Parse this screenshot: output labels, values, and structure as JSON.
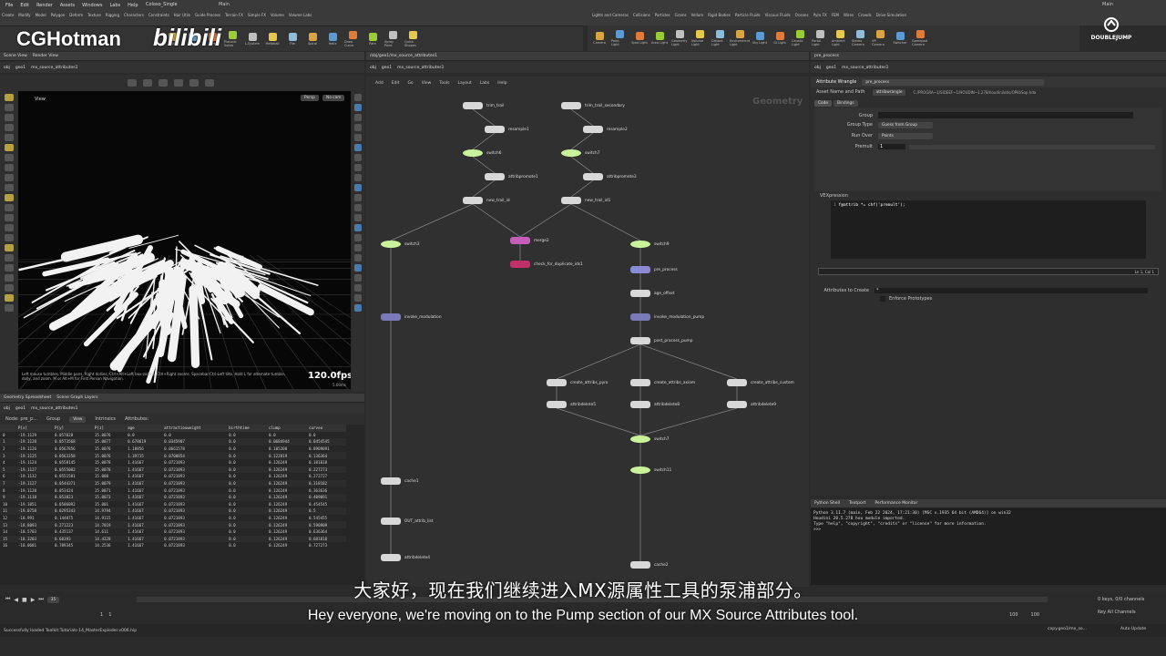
{
  "watermark": {
    "left": "CGHotman",
    "right": "bilibili",
    "brand_right": "DOUBLEJUMP"
  },
  "menubar": {
    "items": [
      "File",
      "Edit",
      "Render",
      "Assets",
      "Windows",
      "Labs",
      "Help"
    ],
    "desktop": "Coloso_Single",
    "main": "Main"
  },
  "shelf_left": [
    "Create",
    "Modify",
    "Model",
    "Polygon",
    "Deform",
    "Texture",
    "Rigging",
    "Characters",
    "Constraints",
    "Hair Utils",
    "Guide Process",
    "Terrain FX",
    "Simple FX",
    "Volume",
    "Volume Labs"
  ],
  "shelf_left_tools": [
    "Null",
    "Text",
    "Font",
    "Platonic Solids",
    "L-System",
    "Metaball",
    "File",
    "Spiral",
    "Helix",
    "Draw Curve",
    "Path",
    "Spray Paint",
    "Quick Shapes"
  ],
  "shelf_right": [
    "Lights and Cameras",
    "Collisions",
    "Particles",
    "Grains",
    "Vellum",
    "Rigid Bodies",
    "Particle Fluids",
    "Viscous Fluids",
    "Oceans",
    "Pyro FX",
    "FEM",
    "Wires",
    "Crowds",
    "Drive Simulation"
  ],
  "shelf_right_tools": [
    "Camera",
    "Point Light",
    "Spot Light",
    "Area Light",
    "Geometry Light",
    "Volume Light",
    "Distant Light",
    "Environment Light",
    "Sky Light",
    "GI Light",
    "Caustic Light",
    "Portal Light",
    "Ambient Light",
    "Stereo Camera",
    "VR Camera",
    "Switcher",
    "Gamepad Camera"
  ],
  "viewport": {
    "tabs": [
      "Scene View",
      "Render View"
    ],
    "path": [
      "obj",
      "geo1",
      "mx_source_attributes1"
    ],
    "view_label": "View",
    "persp": "Persp",
    "cam": "No cam",
    "fps": "120.0fps",
    "fps_ms": "5.69ms",
    "hint": "Left mouse tumbles. Middle pans. Right dollies. Ctrl+Alt+Left box-zooms. Ctrl+Right zooms. Spacebar-Ctrl-Left tilts. Hold L for alternate tumble, dolly, and zoom. M or Alt+M for First Person Navigation."
  },
  "spreadsheet": {
    "tabs": [
      "Geometry Spreadsheet",
      "Scene Graph Layers"
    ],
    "path": [
      "obj",
      "geo1",
      "mx_source_attributes1"
    ],
    "node_label": "Node: pre_p...",
    "group_label": "Group",
    "view_label": "View",
    "intrinsics_label": "Intrinsics",
    "attributes_label": "Attributes:",
    "columns": [
      "",
      "P[x]",
      "P[y]",
      "P[z]",
      "age",
      "attractiouweight",
      "birthtime",
      "clump",
      "curveu"
    ],
    "rows": [
      [
        "0",
        "-19.1129",
        "0.057028",
        "15.0076",
        "0.0",
        "0.0",
        "0.0",
        "0.0",
        "0.0"
      ],
      [
        "1",
        "-19.1128",
        "0.0573568",
        "15.0077",
        "0.678619",
        "0.0345907",
        "0.0",
        "0.0684944",
        "0.0454545"
      ],
      [
        "2",
        "-19.1126",
        "0.0567856",
        "15.0076",
        "1.18856",
        "0.0661578",
        "0.0",
        "0.105208",
        "0.0909091"
      ],
      [
        "3",
        "-19.1125",
        "0.0563358",
        "15.0076",
        "1.39715",
        "0.0700854",
        "0.0",
        "0.122819",
        "0.136364"
      ],
      [
        "4",
        "-19.1124",
        "0.0558145",
        "15.0078",
        "1.41667",
        "0.0721893",
        "0.0",
        "0.126249",
        "0.181818"
      ],
      [
        "5",
        "-19.1127",
        "0.0555082",
        "15.0078",
        "1.41667",
        "0.0721893",
        "0.0",
        "0.126249",
        "0.227273"
      ],
      [
        "6",
        "-19.1132",
        "0.0551581",
        "15.008",
        "1.41667",
        "0.0721893",
        "0.0",
        "0.126249",
        "0.272727"
      ],
      [
        "7",
        "-19.1127",
        "0.0544371",
        "15.0079",
        "1.41667",
        "0.0721893",
        "0.0",
        "0.126249",
        "0.318182"
      ],
      [
        "8",
        "-19.1128",
        "0.053424",
        "15.0071",
        "1.41667",
        "0.0721893",
        "0.0",
        "0.126249",
        "0.363636"
      ],
      [
        "9",
        "-19.1118",
        "0.053023",
        "15.0073",
        "1.41667",
        "0.0721893",
        "0.0",
        "0.126249",
        "0.409091"
      ],
      [
        "10",
        "-19.1051",
        "0.0506092",
        "15.001",
        "1.41667",
        "0.0721893",
        "0.0",
        "0.126249",
        "0.454545"
      ],
      [
        "11",
        "-19.0758",
        "0.0295343",
        "14.9794",
        "1.41667",
        "0.0721893",
        "0.0",
        "0.126249",
        "0.5"
      ],
      [
        "12",
        "-18.991",
        "0.144075",
        "14.9115",
        "1.41667",
        "0.0721893",
        "0.0",
        "0.126249",
        "0.545455"
      ],
      [
        "13",
        "-18.8093",
        "0.271223",
        "14.7819",
        "1.41667",
        "0.0721893",
        "0.0",
        "0.126249",
        "0.590909"
      ],
      [
        "14",
        "-18.5703",
        "0.435137",
        "14.611",
        "1.41667",
        "0.0721893",
        "0.0",
        "0.126249",
        "0.636364"
      ],
      [
        "15",
        "-18.3203",
        "0.60393",
        "14.4328",
        "1.41667",
        "0.0721893",
        "0.0",
        "0.126249",
        "0.681818"
      ],
      [
        "16",
        "-18.0681",
        "0.789345",
        "14.2536",
        "1.41667",
        "0.0721893",
        "0.0",
        "0.126249",
        "0.727273"
      ]
    ]
  },
  "network": {
    "tab": "/obj/geo1/mx_source_attributes1",
    "path": [
      "obj",
      "geo1",
      "mx_source_attributes1"
    ],
    "menu": [
      "Add",
      "Edit",
      "Go",
      "View",
      "Tools",
      "Layout",
      "Labs",
      "Help"
    ],
    "context_label": "Geometry",
    "nodes": [
      {
        "label": "trim_trail",
        "color": "#d8d8d8"
      },
      {
        "label": "resample1",
        "color": "#d8d8d8"
      },
      {
        "label": "switch6",
        "color": "#c9f29b"
      },
      {
        "label": "attribpromote1",
        "color": "#d8d8d8"
      },
      {
        "label": "new_trail_id",
        "color": "#d8d8d8"
      },
      {
        "label": "trim_trail_secondary",
        "color": "#d8d8d8"
      },
      {
        "label": "resample2",
        "color": "#d8d8d8"
      },
      {
        "label": "switch7",
        "color": "#c9f29b"
      },
      {
        "label": "attribpromote3",
        "color": "#d8d8d8"
      },
      {
        "label": "new_trail_id1",
        "color": "#d8d8d8"
      },
      {
        "label": "switch3",
        "color": "#c9f29b"
      },
      {
        "label": "merge2",
        "color": "#c35fb8"
      },
      {
        "label": "check_for_duplicate_ids1",
        "color": "#c0306a"
      },
      {
        "label": "switch9",
        "color": "#c9f29b"
      },
      {
        "label": "pre_process",
        "color": "#8a8ad8"
      },
      {
        "label": "age_offset",
        "color": "#d8d8d8"
      },
      {
        "label": "invoke_modulation",
        "color": "#7a7ab8"
      },
      {
        "label": "invoke_modulation_pump",
        "color": "#7a7ab8"
      },
      {
        "label": "post_process_pump",
        "color": "#d8d8d8"
      },
      {
        "label": "create_attribs_pyro",
        "color": "#d8d8d8"
      },
      {
        "label": "create_attribs_axiom",
        "color": "#d8d8d8"
      },
      {
        "label": "create_attribs_custom",
        "color": "#d8d8d8"
      },
      {
        "label": "attribdelete5",
        "color": "#d8d8d8"
      },
      {
        "label": "attribdelete8",
        "color": "#d8d8d8"
      },
      {
        "label": "attribdelete9",
        "color": "#d8d8d8"
      },
      {
        "label": "switch7",
        "color": "#c9f29b"
      },
      {
        "label": "switch11",
        "color": "#c9f29b"
      },
      {
        "label": "cache1",
        "color": "#d8d8d8"
      },
      {
        "label": "OUT_attrib_list",
        "color": "#d8d8d8"
      },
      {
        "label": "attribdelete4",
        "color": "#d8d8d8"
      },
      {
        "label": "cache2",
        "color": "#d8d8d8"
      }
    ]
  },
  "params": {
    "tab": "pre_process",
    "path": [
      "obj",
      "geo1",
      "mx_source_attributes1"
    ],
    "node_type": "Attribute Wrangle",
    "node_name": "pre_process",
    "asset_label": "Asset Name and Path",
    "asset_name": "attribwrangle",
    "asset_path": "C:/PROGRA~1/SIDEEF~1/HOUDIN~1.278/houdini/otls/OPlibSop.hda",
    "tabs": [
      "Code",
      "Bindings"
    ],
    "group_label": "Group",
    "group_type_label": "Group Type",
    "group_type_value": "Guess from Group",
    "run_over_label": "Run Over",
    "run_over_value": "Points",
    "premult_label": "Premult",
    "premult_value": "1",
    "vex_label": "VEXpression",
    "code": "f@attrib *= chf('premult');",
    "cursor": "Ln 1, Col 1",
    "attr_create_label": "Attributes to Create",
    "attr_create_value": "*",
    "enforce_label": "Enforce Prototypes"
  },
  "pyshell": {
    "tabs": [
      "Python Shell",
      "Textport",
      "Performance Monitor"
    ],
    "lines": [
      "Python 3.11.7 (main, Feb 22 2024, 17:21:30) [MSC v.1935 64 bit (AMD64)] on win32",
      "Houdini 20.5.278 hou module imported.",
      "Type \"help\", \"copyright\", \"credits\" or \"license\" for more information.",
      ">>>"
    ]
  },
  "timeline": {
    "frame": "35",
    "start": "1",
    "end_a": "100",
    "end_b": "100",
    "keys": "0 keys, 0/0 channels",
    "key_all": "Key All Channels",
    "auto_update": "Auto Update"
  },
  "status": {
    "message": "Successfully loaded Toolkit:Tutorials-14_MasterExploder.v006.hip",
    "right": "copy.geo1/mx_so..."
  },
  "subtitles": {
    "cn": "大家好，现在我们继续进入MX源属性工具的泵浦部分。",
    "en": "Hey everyone, we're moving on to the Pump section of our MX Source Attributes tool."
  }
}
